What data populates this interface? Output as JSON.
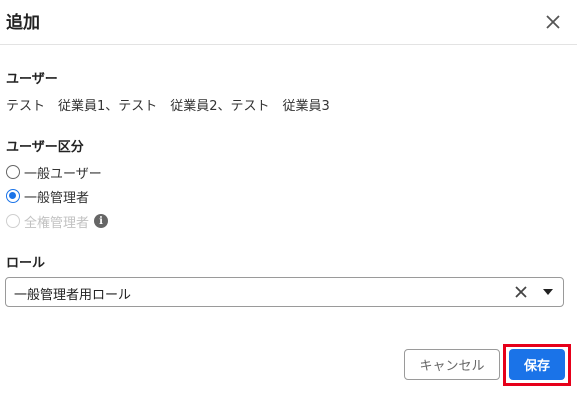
{
  "dialog": {
    "title": "追加",
    "close_icon": "close-icon"
  },
  "users_section": {
    "label": "ユーザー",
    "value": "テスト　従業員1、テスト　従業員2、テスト　従業員3"
  },
  "user_type_section": {
    "label": "ユーザー区分",
    "options": [
      {
        "label": "一般ユーザー",
        "checked": false,
        "disabled": false
      },
      {
        "label": "一般管理者",
        "checked": true,
        "disabled": false
      },
      {
        "label": "全権管理者",
        "checked": false,
        "disabled": true
      }
    ],
    "info_icon": "info-icon"
  },
  "role_section": {
    "label": "ロール",
    "selected": "一般管理者用ロール",
    "clear_icon": "clear-icon",
    "dropdown_icon": "caret-down-icon"
  },
  "footer": {
    "cancel_label": "キャンセル",
    "save_label": "保存"
  },
  "colors": {
    "primary": "#1a73e8",
    "highlight": "#e6001a",
    "disabled_text": "#c2c2c2"
  }
}
